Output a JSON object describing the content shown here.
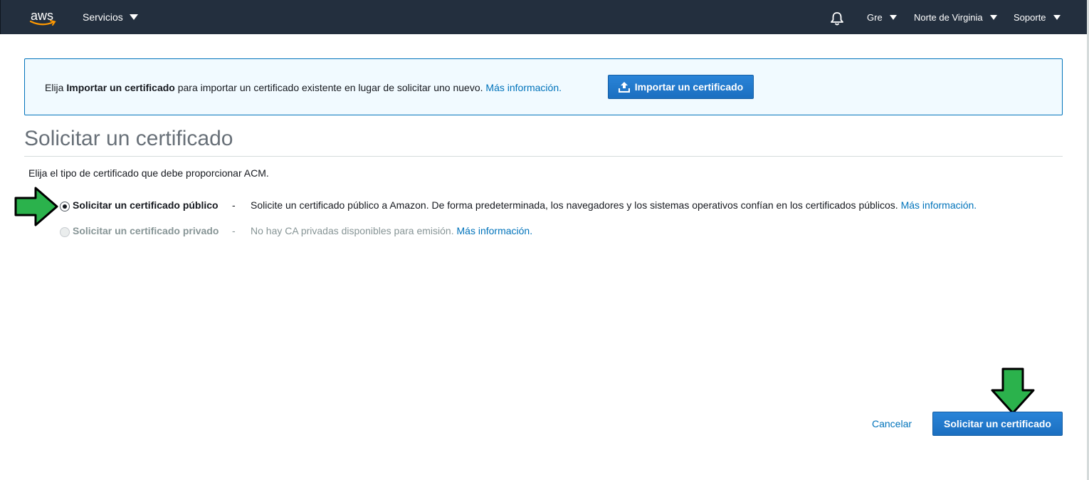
{
  "topnav": {
    "logo_text": "aws",
    "services_label": "Servicios",
    "user_label": "Gre",
    "region_label": "Norte de Virginia",
    "support_label": "Soporte"
  },
  "banner": {
    "text_prefix": "Elija ",
    "text_bold": "Importar un certificado",
    "text_suffix": " para importar un certificado existente en lugar de solicitar uno nuevo. ",
    "link": "Más información.",
    "button_label": "Importar un certificado"
  },
  "page": {
    "title": "Solicitar un certificado",
    "description": "Elija el tipo de certificado que debe proporcionar ACM."
  },
  "options": [
    {
      "label": "Solicitar un certificado público",
      "dash": "-",
      "description": "Solicite un certificado público a Amazon. De forma predeterminada, los navegadores y los sistemas operativos confían en los certificados públicos. ",
      "link": "Más información.",
      "selected": true,
      "disabled": false
    },
    {
      "label": "Solicitar un certificado privado",
      "dash": "-",
      "description": "No hay CA privadas disponibles para emisión. ",
      "link": "Más información.",
      "selected": false,
      "disabled": true
    }
  ],
  "footer": {
    "cancel_label": "Cancelar",
    "submit_label": "Solicitar un certificado"
  },
  "colors": {
    "nav_bg": "#232f3e",
    "primary": "#1f7cd1",
    "link": "#0073bb",
    "annotation_arrow": "#2bb24c"
  }
}
